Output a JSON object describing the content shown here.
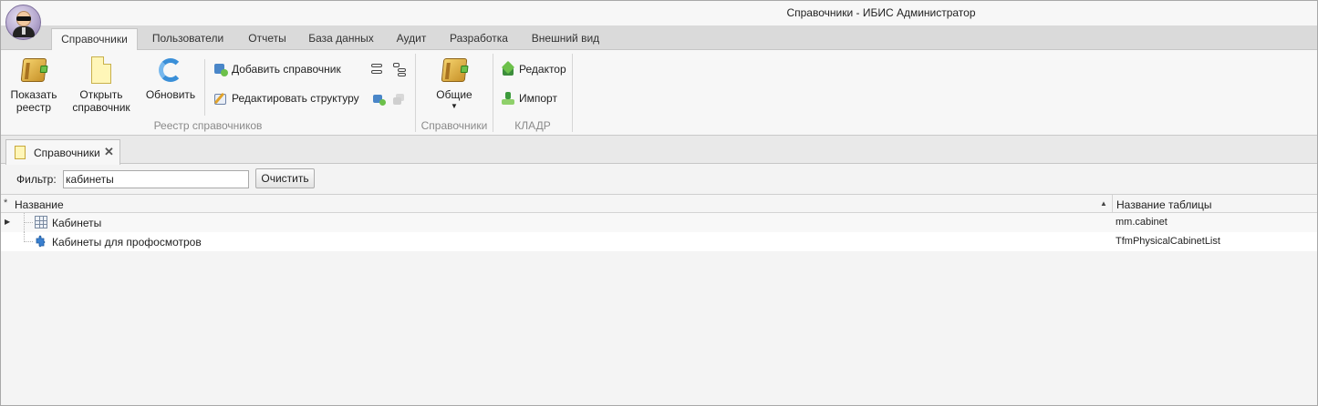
{
  "window": {
    "title": "Справочники - ИБИС Администратор"
  },
  "ribbon_tabs": [
    {
      "label": "Справочники",
      "active": true
    },
    {
      "label": "Пользователи",
      "active": false
    },
    {
      "label": "Отчеты",
      "active": false
    },
    {
      "label": "База данных",
      "active": false
    },
    {
      "label": "Аудит",
      "active": false
    },
    {
      "label": "Разработка",
      "active": false
    },
    {
      "label": "Внешний вид",
      "active": false
    }
  ],
  "ribbon": {
    "registry_group": {
      "label": "Реестр справочников",
      "show_registry": {
        "line1": "Показать",
        "line2": "реестр",
        "icon": "book-icon"
      },
      "open_directory": {
        "line1": "Открыть",
        "line2": "справочник",
        "icon": "document-icon"
      },
      "refresh": {
        "label": "Обновить",
        "icon": "refresh-icon"
      },
      "add_directory": {
        "label": "Добавить справочник",
        "icon": "add-directory-icon"
      },
      "edit_structure": {
        "label": "Редактировать структуру",
        "icon": "edit-structure-icon"
      }
    },
    "directories_group": {
      "label": "Справочники",
      "general": {
        "label": "Общие",
        "icon": "book-icon"
      }
    },
    "kladr_group": {
      "label": "КЛАДР",
      "editor": {
        "label": "Редактор",
        "icon": "house-icon"
      },
      "import": {
        "label": "Импорт",
        "icon": "import-icon"
      }
    }
  },
  "doc_tab": {
    "label": "Справочники",
    "close": "✕"
  },
  "filter": {
    "label": "Фильтр:",
    "value": "кабинеты",
    "clear_label": "Очистить"
  },
  "grid": {
    "columns": {
      "marker": "*",
      "name": "Название",
      "sort_indicator": "▲",
      "table": "Название таблицы"
    },
    "rows": [
      {
        "name": "Кабинеты",
        "table": "mm.cabinet",
        "icon": "table-icon",
        "indicator": "▶"
      },
      {
        "name": "Кабинеты для профосмотров",
        "table": "TfmPhysicalCabinetList",
        "icon": "puzzle-icon",
        "indicator": ""
      }
    ]
  },
  "colors": {
    "accent_blue": "#3a8fd8",
    "green": "#6cc04a",
    "gold": "#c79128"
  }
}
